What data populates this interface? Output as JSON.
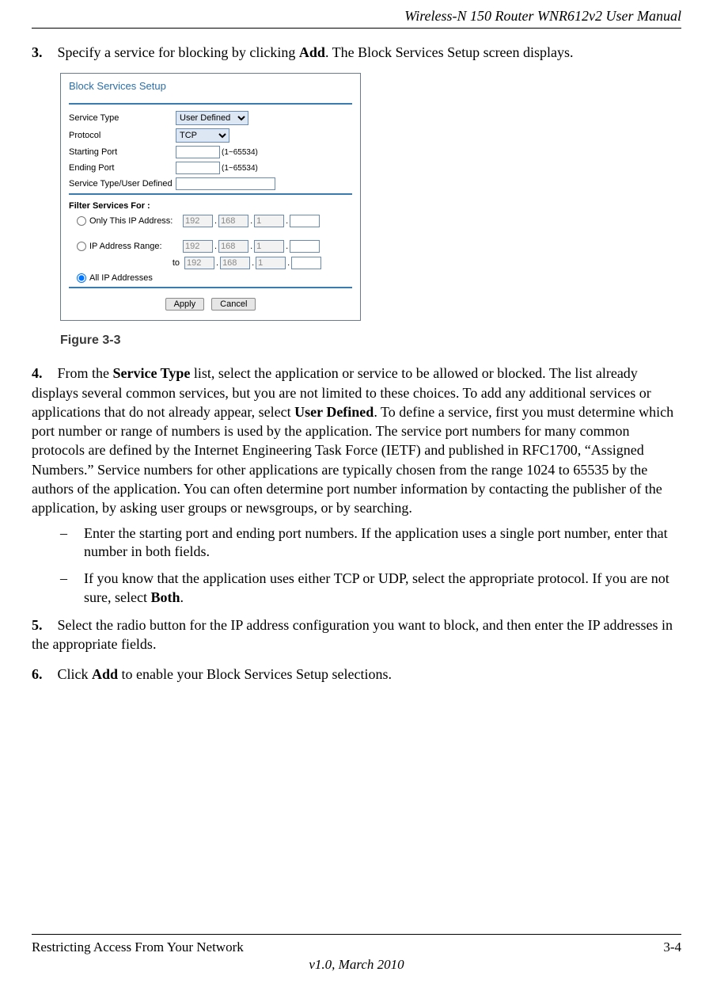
{
  "header": {
    "doc_title": "Wireless-N 150 Router WNR612v2 User Manual"
  },
  "steps": {
    "s3": {
      "num": "3.",
      "pre": "Specify a service for blocking by clicking ",
      "bold": "Add",
      "post": ". The Block Services Setup screen displays."
    },
    "s4": {
      "num": "4.",
      "part1_pre": "From the ",
      "part1_b1": "Service Type",
      "part1_mid": " list, select the application or service to be allowed or blocked. The list already displays several common services, but you are not limited to these choices. To add any additional services or applications that do not already appear, select ",
      "part1_b2": "User Defined",
      "part1_post": ". To define a service, first you must determine which port number or range of numbers is used by the application. The service port numbers for many common protocols are defined by the Internet Engineering Task Force (IETF) and published in RFC1700, “Assigned Numbers.” Service numbers for other applications are typically chosen from the range 1024 to 65535 by the authors of the application. You can often determine port number information by contacting the publisher of the application, by asking user groups or newsgroups, or by searching."
    },
    "s4a": {
      "dash": "–",
      "text": "Enter the starting port and ending port numbers. If the application uses a single port number, enter that number in both fields."
    },
    "s4b": {
      "dash": "–",
      "pre": "If you know that the application uses either TCP or UDP, select the appropriate protocol. If you are not sure, select ",
      "bold": "Both",
      "post": "."
    },
    "s5": {
      "num": "5.",
      "text": "Select the radio button for the IP address configuration you want to block, and then enter the IP addresses in the appropriate fields."
    },
    "s6": {
      "num": "6.",
      "pre": "Click ",
      "bold": "Add",
      "post": " to enable your Block Services Setup selections."
    }
  },
  "figure": {
    "caption": "Figure 3-3",
    "title": "Block Services Setup",
    "labels": {
      "service_type": "Service Type",
      "protocol": "Protocol",
      "starting_port": "Starting Port",
      "ending_port": "Ending Port",
      "user_def": "Service Type/User Defined",
      "filter_for": "Filter Services For :",
      "only_this": "Only This IP Address:",
      "range": "IP Address Range:",
      "to": "to",
      "all": "All IP Addresses"
    },
    "values": {
      "service_type_sel": "User Defined",
      "protocol_sel": "TCP",
      "port_hint": "(1~65534)",
      "ip1": "192",
      "ip2": "168",
      "ip3": "1",
      "ip4": "",
      "apply": "Apply",
      "cancel": "Cancel"
    }
  },
  "footer": {
    "left": "Restricting Access From Your Network",
    "right": "3-4",
    "version": "v1.0, March 2010"
  }
}
